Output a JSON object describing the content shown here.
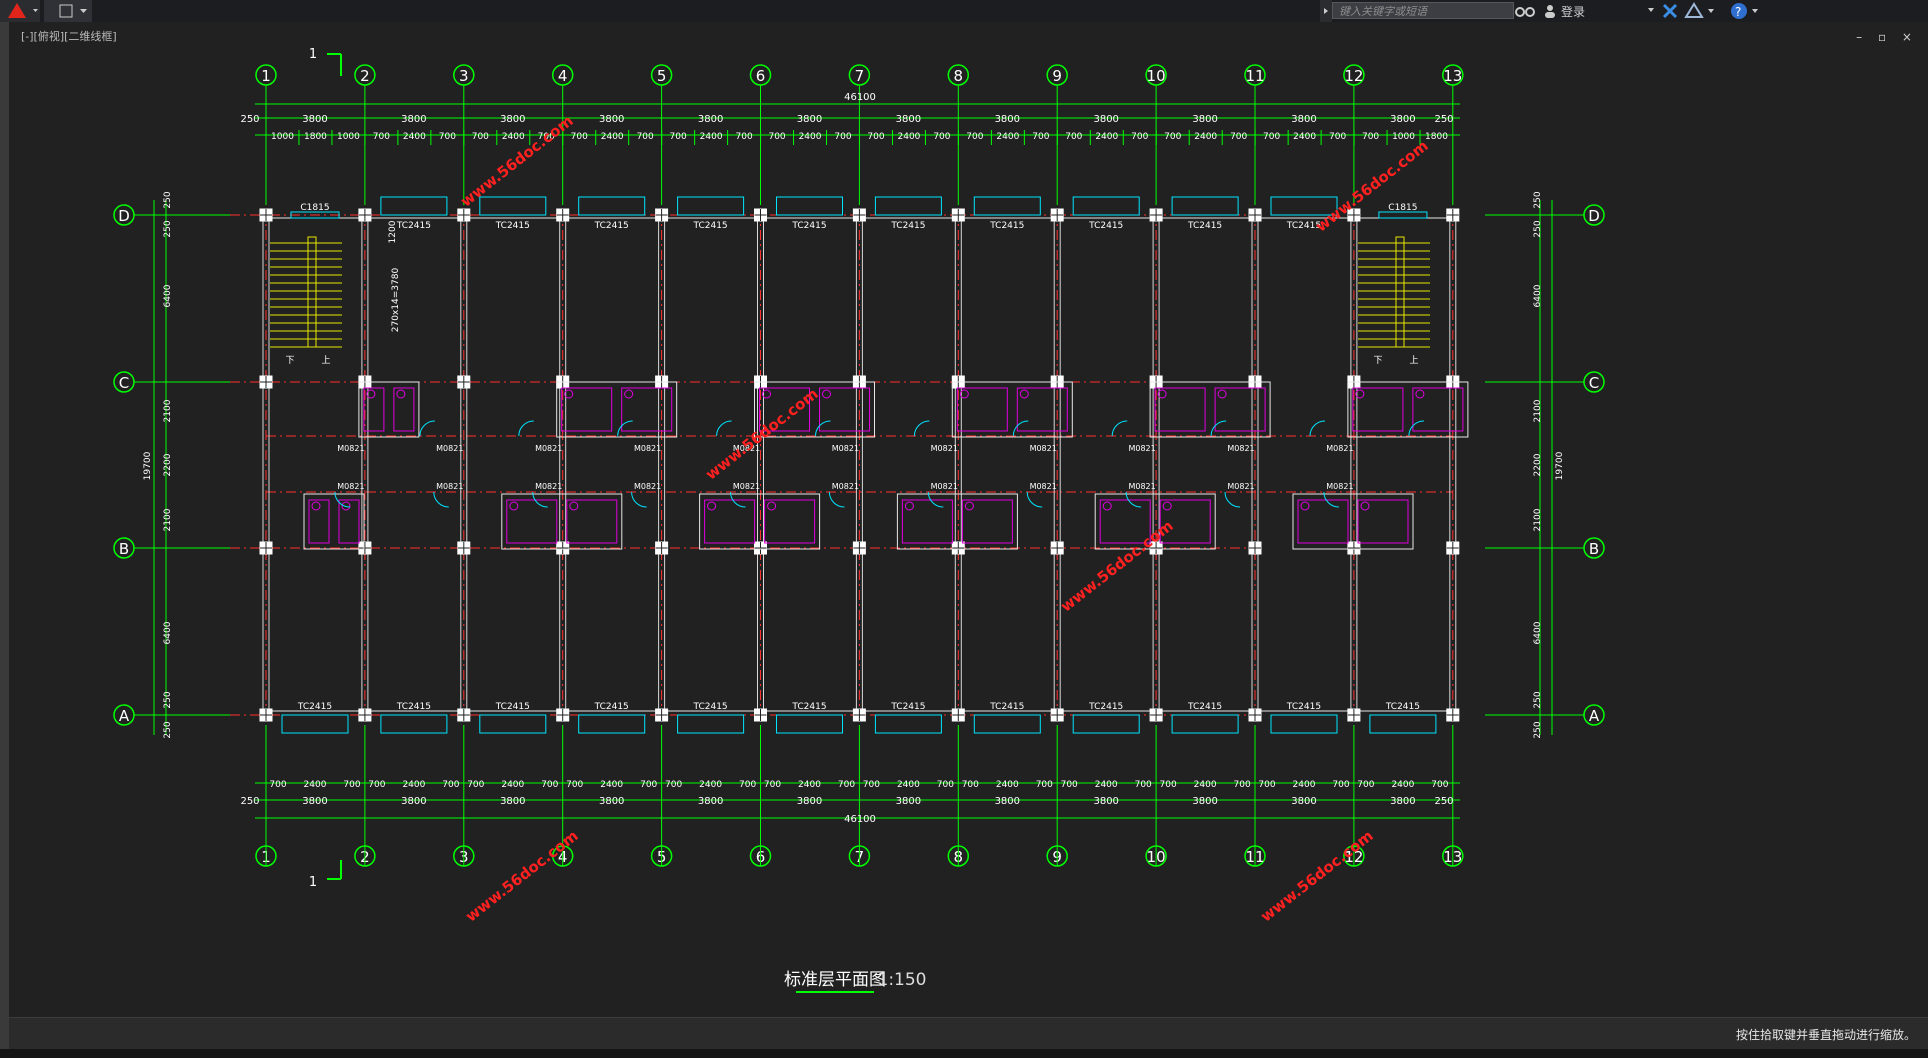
{
  "app": {
    "view_label": "[-][俯视][二维线框]",
    "search_placeholder": "键入关键字或短语",
    "login_label": "登录",
    "status_text": "按住拾取键并垂直拖动进行缩放。",
    "window_controls": "– ▫ ×"
  },
  "drawing": {
    "title": "标准层平面图",
    "scale": "1:150",
    "section_label": "1",
    "axis_numbers": [
      "1",
      "2",
      "3",
      "4",
      "5",
      "6",
      "7",
      "8",
      "9",
      "10",
      "11",
      "12",
      "13"
    ],
    "axis_letters": [
      "D",
      "C",
      "B",
      "A"
    ],
    "total_width": "46100",
    "total_depth": "19700",
    "bay_dims": [
      "3800",
      "3800",
      "3800",
      "3800",
      "3800",
      "3800",
      "3800",
      "3800",
      "3800",
      "3800",
      "3800",
      "3800"
    ],
    "end_offset": "250",
    "top_detail": [
      "1000",
      "1800",
      "1000",
      "700",
      "2400",
      "700",
      "700",
      "2400",
      "700",
      "700",
      "2400",
      "700",
      "700",
      "2400",
      "700",
      "700",
      "2400",
      "700",
      "700",
      "2400",
      "700",
      "700",
      "2400",
      "700",
      "700",
      "2400",
      "700",
      "700",
      "2400",
      "700",
      "700",
      "2400",
      "700",
      "700",
      "1000",
      "1800"
    ],
    "bottom_detail_pattern": [
      "700",
      "2400",
      "700"
    ],
    "vertical_dims": [
      "250",
      "250",
      "6400",
      "2100",
      "2200",
      "2100",
      "6400",
      "250",
      "250"
    ],
    "window_labels": {
      "top_end": "C1815",
      "top": "TC2415",
      "bottom": "TC2415"
    },
    "door_label": "M0821",
    "stair_label": "270x14=3780",
    "stair_up": "上",
    "stair_down": "下",
    "dim_1200": "1200",
    "watermark": "www.56doc.com"
  },
  "colors": {
    "canvas": "#212121",
    "axis_green": "#00ff00",
    "column_white": "#ffffff",
    "wall_red": "#ff3030",
    "window_cyan": "#00e5ff",
    "fixture_magenta": "#e000e0",
    "stair_yellow": "#e6e600",
    "watermark_red": "#ff2020"
  }
}
